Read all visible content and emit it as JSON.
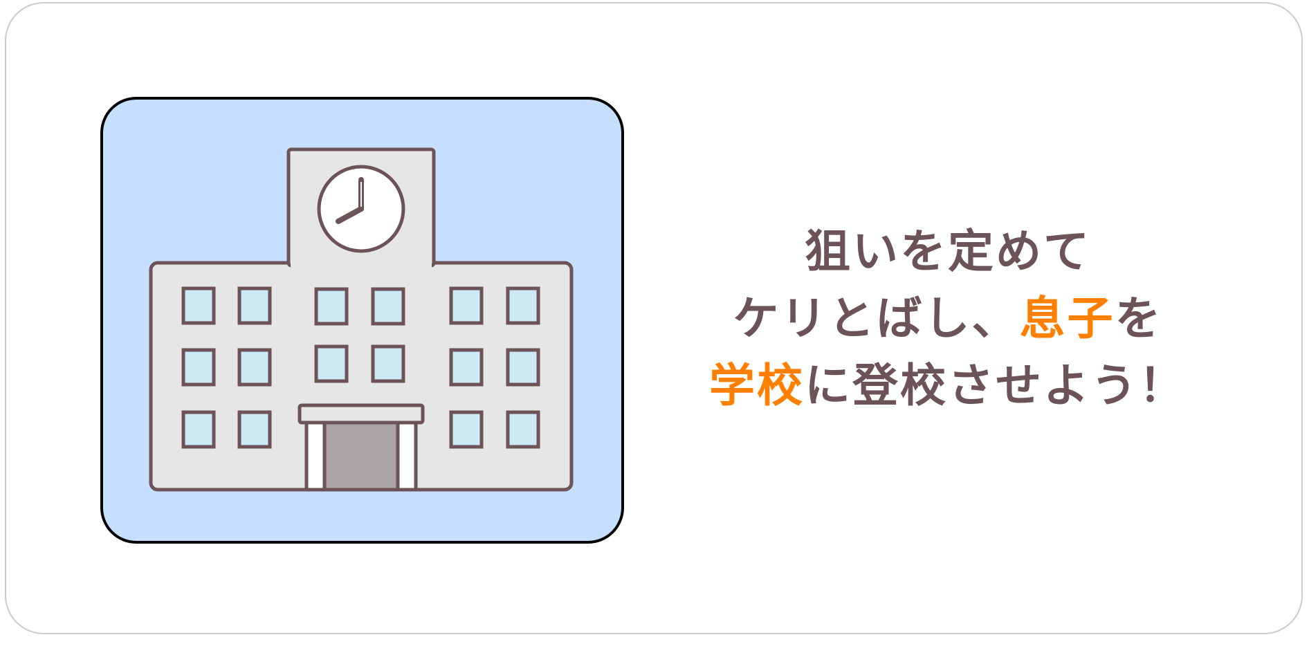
{
  "illustration": {
    "name": "school-building",
    "colors": {
      "panel": "#c6dffc",
      "outline": "#000000",
      "building": "#e6e6e6",
      "stroke": "#6b5358",
      "window": "#cde9f6",
      "door": "#aaa5a4",
      "clock_face": "#ffffff"
    }
  },
  "caption": {
    "line1": "狙いを定めて",
    "line2_a": "ケリとばし、",
    "line2_highlight": "息子",
    "line2_b": "を",
    "line3_highlight": "学校",
    "line3_b": "に登校させよう！",
    "text_color": "#6b5358",
    "highlight_color": "#ff7f00"
  }
}
